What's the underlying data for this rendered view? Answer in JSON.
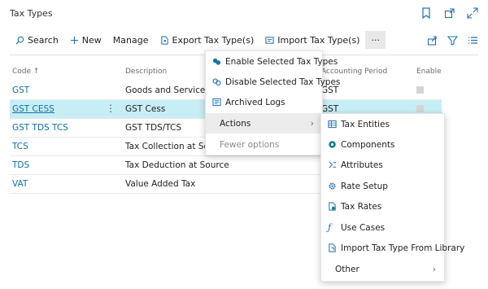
{
  "page": {
    "title": "Tax Types"
  },
  "toolbar": {
    "search": "Search",
    "new": "New",
    "manage": "Manage",
    "export": "Export Tax Type(s)",
    "import": "Import Tax Type(s)",
    "more": "···"
  },
  "columns": {
    "code": "Code ↑",
    "description": "Description",
    "accounting_period": "Accounting Period",
    "enable": "Enable"
  },
  "rows": [
    {
      "code": "GST",
      "description": "Goods and Service Tax",
      "accounting_period": "GST",
      "enable": true
    },
    {
      "code": "GST CESS",
      "description": "GST Cess",
      "accounting_period": "GST",
      "enable": true,
      "row_actions": "⋮"
    },
    {
      "code": "GST TDS TCS",
      "description": "GST TDS/TCS",
      "accounting_period": "",
      "enable": null
    },
    {
      "code": "TCS",
      "description": "Tax Collection at Source",
      "accounting_period": "",
      "enable": null
    },
    {
      "code": "TDS",
      "description": "Tax Deduction at Source",
      "accounting_period": "",
      "enable": null
    },
    {
      "code": "VAT",
      "description": "Value Added Tax",
      "accounting_period": "",
      "enable": null
    }
  ],
  "menu": {
    "enable_selected": "Enable Selected Tax Types",
    "disable_selected": "Disable Selected Tax Types",
    "archived_logs": "Archived Logs",
    "actions": "Actions",
    "fewer_options": "Fewer options"
  },
  "submenu": {
    "tax_entities": "Tax Entities",
    "components": "Components",
    "attributes": "Attributes",
    "rate_setup": "Rate Setup",
    "tax_rates": "Tax Rates",
    "use_cases": "Use Cases",
    "import_library": "Import Tax Type From Library",
    "other": "Other"
  },
  "colors": {
    "accent": "#0f6fa8",
    "selected_row": "#c7eef5",
    "menu_highlight": "#ececec",
    "icon_blue": "#1f6fb5",
    "icon_teal": "#0a7d8c"
  }
}
